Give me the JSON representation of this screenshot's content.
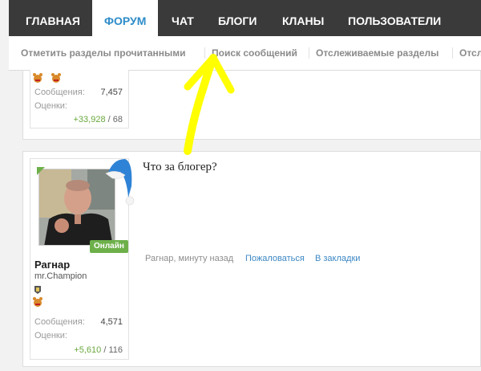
{
  "nav": {
    "items": [
      "ГЛАВНАЯ",
      "ФОРУМ",
      "ЧАТ",
      "БЛОГИ",
      "КЛАНЫ",
      "ПОЛЬЗОВАТЕЛИ"
    ],
    "active": "ФОРУМ"
  },
  "subnav": {
    "items": [
      "Отметить разделы прочитанными",
      "Поиск сообщений",
      "Отслеживаемые разделы",
      "Отсл"
    ]
  },
  "prev_post": {
    "stats": {
      "messages_label": "Сообщения:",
      "messages_value": "7,457",
      "ratings_label": "Оценки:",
      "ratings_positive": "+33,928",
      "ratings_sep": " / ",
      "ratings_total": "68"
    }
  },
  "post": {
    "text": "Что за блогер?",
    "user": {
      "name": "Рагнар",
      "title": "mr.Champion",
      "online_badge": "Онлайн"
    },
    "stats": {
      "messages_label": "Сообщения:",
      "messages_value": "4,571",
      "ratings_label": "Оценки:",
      "ratings_positive": "+5,610",
      "ratings_sep": " / ",
      "ratings_total": "116"
    },
    "footer": {
      "meta": "Рагнар, минуту назад",
      "report": "Пожаловаться",
      "bookmark": "В закладки"
    }
  },
  "colors": {
    "nav_bg": "#3a3a3a",
    "accent": "#2d8bc9",
    "online": "#6db04a",
    "annotation": "#ffff00"
  }
}
